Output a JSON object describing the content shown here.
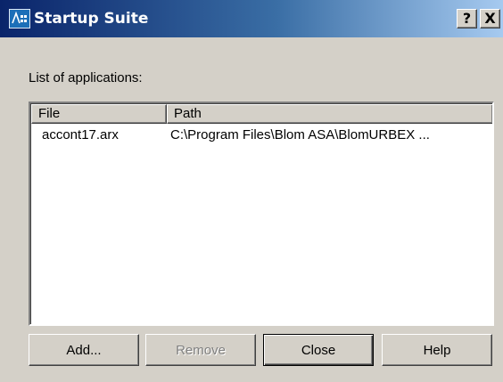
{
  "window": {
    "title": "Startup Suite",
    "help_button": "?",
    "close_button": "X",
    "icon": "app-icon"
  },
  "list": {
    "caption": "List of applications:",
    "columns": [
      "File",
      "Path"
    ],
    "rows": [
      {
        "file": "accont17.arx",
        "path": "C:\\Program Files\\Blom ASA\\BlomURBEX ..."
      }
    ]
  },
  "buttons": {
    "add": "Add...",
    "remove": "Remove",
    "close": "Close",
    "help": "Help"
  }
}
